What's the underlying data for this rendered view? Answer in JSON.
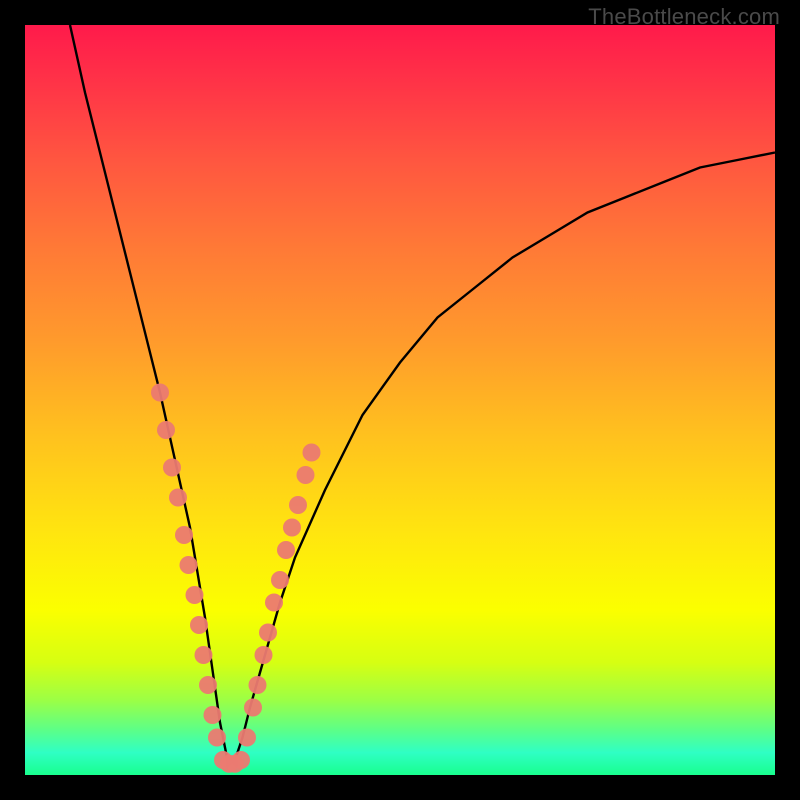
{
  "watermark": "TheBottleneck.com",
  "colors": {
    "dot": "#eb7a71",
    "curve": "#000000",
    "frame_bg_top": "#ff1a4b",
    "frame_bg_bottom": "#19ff8e",
    "page_bg": "#000000"
  },
  "chart_data": {
    "type": "line",
    "title": "",
    "xlabel": "",
    "ylabel": "",
    "xlim": [
      0,
      100
    ],
    "ylim": [
      0,
      100
    ],
    "grid": false,
    "notes": "V-shaped bottleneck curve on rainbow gradient. Y is visual height (0 at bottom). Minimum near x≈27. Dots cluster around the trough.",
    "series": [
      {
        "name": "bottleneck-curve",
        "x": [
          6,
          8,
          10,
          12,
          14,
          16,
          18,
          20,
          22,
          24,
          25,
          26,
          27,
          28,
          29,
          30,
          32,
          34,
          36,
          40,
          45,
          50,
          55,
          60,
          65,
          70,
          75,
          80,
          85,
          90,
          95,
          100
        ],
        "y": [
          100,
          91,
          83,
          75,
          67,
          59,
          51,
          42,
          33,
          21,
          14,
          7,
          2,
          2,
          5,
          9,
          16,
          23,
          29,
          38,
          48,
          55,
          61,
          65,
          69,
          72,
          75,
          77,
          79,
          81,
          82,
          83
        ]
      }
    ],
    "dots": [
      {
        "x": 18.0,
        "y": 51
      },
      {
        "x": 18.8,
        "y": 46
      },
      {
        "x": 19.6,
        "y": 41
      },
      {
        "x": 20.4,
        "y": 37
      },
      {
        "x": 21.2,
        "y": 32
      },
      {
        "x": 21.8,
        "y": 28
      },
      {
        "x": 22.6,
        "y": 24
      },
      {
        "x": 23.2,
        "y": 20
      },
      {
        "x": 23.8,
        "y": 16
      },
      {
        "x": 24.4,
        "y": 12
      },
      {
        "x": 25.0,
        "y": 8
      },
      {
        "x": 25.6,
        "y": 5
      },
      {
        "x": 26.4,
        "y": 2
      },
      {
        "x": 27.2,
        "y": 1.5
      },
      {
        "x": 28.0,
        "y": 1.5
      },
      {
        "x": 28.8,
        "y": 2
      },
      {
        "x": 29.6,
        "y": 5
      },
      {
        "x": 30.4,
        "y": 9
      },
      {
        "x": 31.0,
        "y": 12
      },
      {
        "x": 31.8,
        "y": 16
      },
      {
        "x": 32.4,
        "y": 19
      },
      {
        "x": 33.2,
        "y": 23
      },
      {
        "x": 34.0,
        "y": 26
      },
      {
        "x": 34.8,
        "y": 30
      },
      {
        "x": 35.6,
        "y": 33
      },
      {
        "x": 36.4,
        "y": 36
      },
      {
        "x": 37.4,
        "y": 40
      },
      {
        "x": 38.2,
        "y": 43
      }
    ]
  }
}
